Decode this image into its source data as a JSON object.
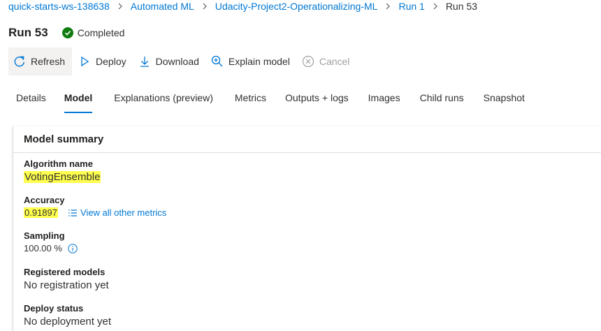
{
  "breadcrumb": {
    "items": [
      "quick-starts-ws-138638",
      "Automated ML",
      "Udacity-Project2-Operationalizing-ML",
      "Run 1"
    ],
    "current": "Run 53"
  },
  "header": {
    "title": "Run 53",
    "status": "Completed",
    "status_color": "#107c10"
  },
  "toolbar": {
    "refresh": "Refresh",
    "deploy": "Deploy",
    "download": "Download",
    "explain": "Explain model",
    "cancel": "Cancel"
  },
  "tabs": [
    "Details",
    "Model",
    "Explanations (preview)",
    "Metrics",
    "Outputs + logs",
    "Images",
    "Child runs",
    "Snapshot"
  ],
  "active_tab": "Model",
  "accent_color": "#0078d4",
  "highlight_color": "#ffff4d",
  "model_summary": {
    "title": "Model summary",
    "algorithm_label": "Algorithm name",
    "algorithm_value": "VotingEnsemble",
    "accuracy_label": "Accuracy",
    "accuracy_value": "0.91897",
    "view_metrics_link": "View all other metrics",
    "sampling_label": "Sampling",
    "sampling_value": "100.00 %",
    "registered_label": "Registered models",
    "registered_value": "No registration yet",
    "deploy_label": "Deploy status",
    "deploy_value": "No deployment yet"
  }
}
